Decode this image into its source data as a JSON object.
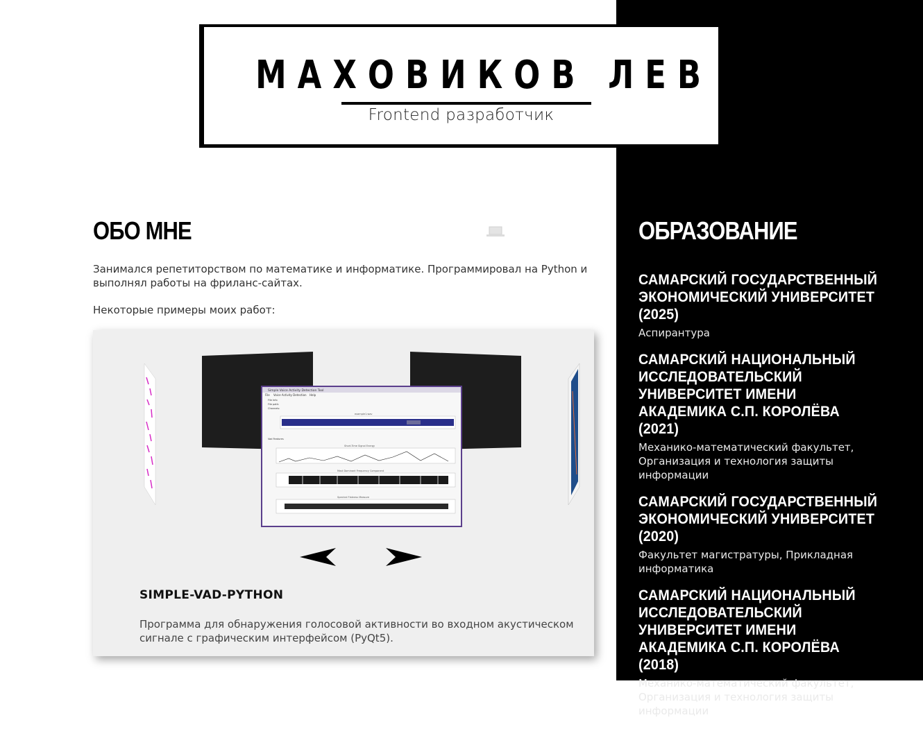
{
  "header": {
    "name": "МАХОВИКОВ ЛЕВ",
    "subtitle": "Frontend разработчик"
  },
  "about": {
    "title": "ОБО МНЕ",
    "paragraph1": "Занимался репетиторством по математике и информатике. Программировал на Python и выполнял работы на фриланс-сайтах.",
    "paragraph2": "Некоторые примеры моих работ:",
    "icon": "laptop-icon"
  },
  "slider": {
    "project_title": "SIMPLE-VAD-PYTHON",
    "project_description": "Программа для обнаружения голосовой активности во входном акустическом сигнале с графическим интерфейсом (PyQt5).",
    "screenshot": {
      "window_title": "Simple Voice Activity Detection Tool",
      "menu": [
        "File",
        "Voice Activity Detection",
        "Help"
      ],
      "file_info_label": "File Info",
      "file_path_label": "File path:",
      "channels_label": "Channels:",
      "plot_titles": [
        "example1.wav",
        "Short-Time Signal Energy",
        "Most Dominant Frequency Component",
        "Spectral Flatness Measure"
      ],
      "vad_features_label": "Vad Features"
    },
    "prev_icon": "arrow-left-icon",
    "next_icon": "arrow-right-icon"
  },
  "education": {
    "title": "ОБРАЗОВАНИЕ",
    "items": [
      {
        "name": "САМАРСКИЙ ГОСУДАРСТВЕННЫЙ ЭКОНОМИЧЕСКИЙ УНИВЕРСИТЕТ (2025)",
        "description": "Аспирантура"
      },
      {
        "name": "САМАРСКИЙ НАЦИОНАЛЬНЫЙ ИССЛЕДОВАТЕЛЬСКИЙ УНИВЕРСИТЕТ ИМЕНИ АКАДЕМИКА С.П. КОРОЛЁВА (2021)",
        "description": "Механико-математический факультет, Организация и технология защиты информации"
      },
      {
        "name": "САМАРСКИЙ ГОСУДАРСТВЕННЫЙ ЭКОНОМИЧЕСКИЙ УНИВЕРСИТЕТ (2020)",
        "description": "Факультет магистратуры, Прикладная информатика"
      },
      {
        "name": "САМАРСКИЙ НАЦИОНАЛЬНЫЙ ИССЛЕДОВАТЕЛЬСКИЙ УНИВЕРСИТЕТ ИМЕНИ АКАДЕМИКА С.П. КОРОЛЁВА (2018)",
        "description": "Механико-математический факультет, Организация и технология защиты информации"
      }
    ]
  },
  "colors": {
    "background": "#ffffff",
    "sidebar": "#000000",
    "slider_bg": "#efefef",
    "accent_purple": "#5b3f8c"
  }
}
